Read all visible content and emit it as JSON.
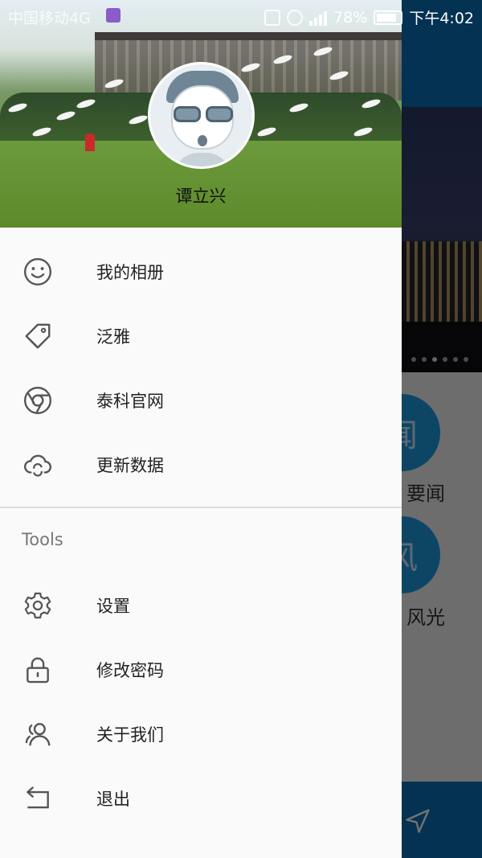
{
  "status_bar": {
    "carrier": "中国移动4G",
    "network": "4G",
    "battery": "78%",
    "time": "下午4:02",
    "icons": [
      "gallery-icon",
      "vibrate-icon",
      "alarm-icon",
      "signal-icon",
      "battery-icon"
    ]
  },
  "drawer": {
    "user_name": "谭立兴",
    "menu": [
      {
        "label": "我的相册",
        "icon": "smiley-icon"
      },
      {
        "label": "泛雅",
        "icon": "tag-icon"
      },
      {
        "label": "泰科官网",
        "icon": "chrome-icon"
      },
      {
        "label": "更新数据",
        "icon": "cloud-sync-icon"
      }
    ],
    "tools_title": "Tools",
    "tools": [
      {
        "label": "设置",
        "icon": "gear-icon"
      },
      {
        "label": "修改密码",
        "icon": "lock-icon"
      },
      {
        "label": "关于我们",
        "icon": "people-icon"
      },
      {
        "label": "退出",
        "icon": "exit-icon"
      }
    ]
  },
  "background_app": {
    "tiles": [
      {
        "glyph": "闻",
        "label": "要闻"
      },
      {
        "glyph": "风",
        "label": "风光"
      }
    ],
    "colors": {
      "primary": "#0a6fb5",
      "tile": "#1e9be0"
    }
  }
}
